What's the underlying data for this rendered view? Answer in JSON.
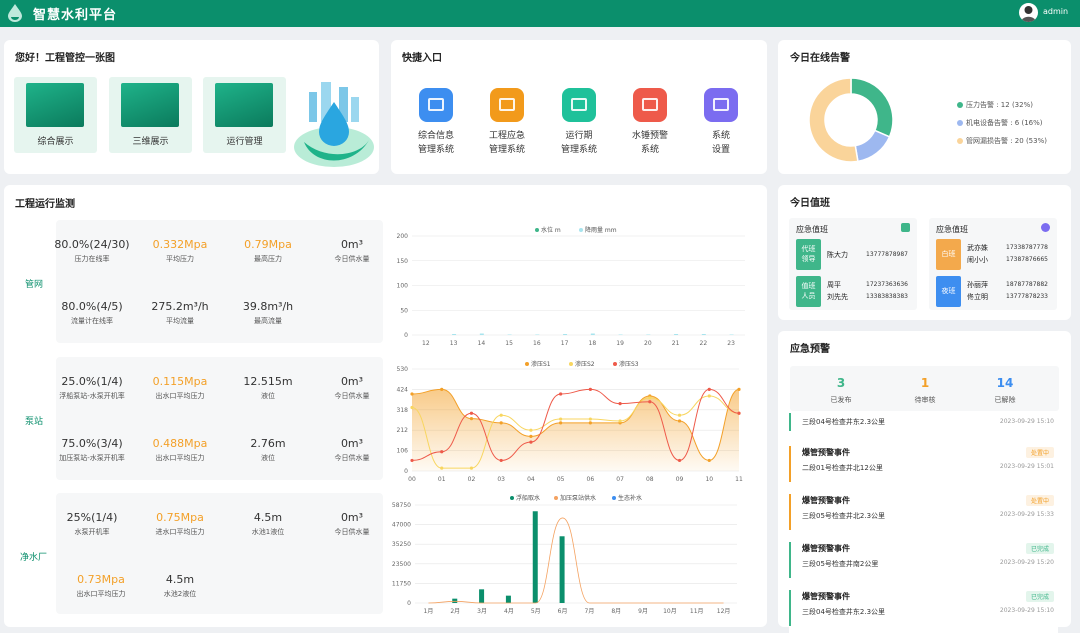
{
  "app": {
    "title": "智慧水利平台",
    "user": "admin"
  },
  "overview": {
    "title": "您好！工程管控一张图",
    "tiles": [
      "综合展示",
      "三维展示",
      "运行管理"
    ]
  },
  "quick": {
    "title": "快捷入口",
    "items": [
      {
        "l1": "综合信息",
        "l2": "管理系统",
        "color": "#3d8ef0"
      },
      {
        "l1": "工程应急",
        "l2": "管理系统",
        "color": "#f29a1b"
      },
      {
        "l1": "运行期",
        "l2": "管理系统",
        "color": "#1fc19a"
      },
      {
        "l1": "水锤预警",
        "l2": "系统",
        "color": "#ee5a4a"
      },
      {
        "l1": "系统",
        "l2": "设置",
        "color": "#7b6cf0"
      }
    ]
  },
  "alarms": {
    "title": "今日在线告警",
    "items": [
      {
        "label": "压力告警 : 12 (32%)",
        "value": 12,
        "color": "#3fb68a"
      },
      {
        "label": "机电设备告警 : 6 (16%)",
        "value": 6,
        "color": "#9db8f0"
      },
      {
        "label": "管网漏损告警 : 20 (53%)",
        "value": 20,
        "color": "#fad49a"
      }
    ]
  },
  "monitor": {
    "title": "工程运行监测",
    "sections": [
      {
        "name": "管网",
        "rows": [
          [
            {
              "v": "80.0%(24/30)",
              "l": "压力在线率"
            },
            {
              "v": "0.332Mpa",
              "l": "平均压力",
              "o": true
            },
            {
              "v": "0.79Mpa",
              "l": "最高压力",
              "o": true
            },
            {
              "v": "0m³",
              "l": "今日供水量"
            }
          ],
          [
            {
              "v": "80.0%(4/5)",
              "l": "流量计在线率"
            },
            {
              "v": "275.2m³/h",
              "l": "平均流量"
            },
            {
              "v": "39.8m³/h",
              "l": "最高流量"
            }
          ]
        ]
      },
      {
        "name": "泵站",
        "rows": [
          [
            {
              "v": "25.0%(1/4)",
              "l": "浮船泵站-水泵开机率"
            },
            {
              "v": "0.115Mpa",
              "l": "出水口平均压力",
              "o": true
            },
            {
              "v": "12.515m",
              "l": "液位"
            },
            {
              "v": "0m³",
              "l": "今日供水量"
            }
          ],
          [
            {
              "v": "75.0%(3/4)",
              "l": "加压泵站-水泵开机率"
            },
            {
              "v": "0.488Mpa",
              "l": "出水口平均压力",
              "o": true
            },
            {
              "v": "2.76m",
              "l": "液位"
            },
            {
              "v": "0m³",
              "l": "今日供水量"
            }
          ]
        ]
      },
      {
        "name": "净水厂",
        "rows": [
          [
            {
              "v": "25%(1/4)",
              "l": "水泵开机率"
            },
            {
              "v": "0.75Mpa",
              "l": "进水口平均压力",
              "o": true
            },
            {
              "v": "4.5m",
              "l": "水池1液位"
            },
            {
              "v": "0m³",
              "l": "今日供水量"
            }
          ],
          [
            {
              "v": "0.73Mpa",
              "l": "出水口平均压力",
              "o": true
            },
            {
              "v": "4.5m",
              "l": "水池2液位"
            }
          ]
        ]
      }
    ]
  },
  "chart_data": [
    {
      "type": "bar",
      "categories": [
        "12",
        "13",
        "14",
        "15",
        "16",
        "17",
        "18",
        "19",
        "20",
        "21",
        "22",
        "23"
      ],
      "series": [
        {
          "name": "水位 m",
          "values": [
            0,
            0,
            0,
            0,
            0,
            0,
            0,
            0,
            0,
            0,
            0,
            0
          ],
          "color": "#3fb68a"
        },
        {
          "name": "降雨量 mm",
          "values": [
            0,
            2,
            3,
            1,
            1,
            2,
            3,
            1,
            1,
            2,
            2,
            1
          ],
          "color": "#a8e4ee"
        }
      ],
      "yticks": [
        "200",
        "150",
        "100",
        "50",
        "0"
      ],
      "ylim": [
        0,
        200
      ]
    },
    {
      "type": "line",
      "categories": [
        "00",
        "01",
        "02",
        "03",
        "04",
        "05",
        "06",
        "07",
        "08",
        "09",
        "10",
        "11"
      ],
      "series": [
        {
          "name": "渗压S1",
          "values": [
            400,
            424,
            272,
            250,
            180,
            250,
            250,
            250,
            390,
            260,
            55,
            424
          ],
          "color": "#f3a028"
        },
        {
          "name": "渗压S2",
          "values": [
            330,
            15,
            15,
            290,
            212,
            270,
            270,
            260,
            380,
            290,
            390,
            300
          ],
          "color": "#f8d660"
        },
        {
          "name": "渗压S3",
          "values": [
            55,
            100,
            300,
            55,
            150,
            400,
            424,
            350,
            360,
            55,
            424,
            300
          ],
          "color": "#ee5a4a"
        }
      ],
      "yticks": [
        "530",
        "424",
        "318",
        "212",
        "106",
        "0"
      ],
      "ylim": [
        0,
        530
      ]
    },
    {
      "type": "bar",
      "categories": [
        "1月",
        "2月",
        "3月",
        "4月",
        "5月",
        "6月",
        "7月",
        "8月",
        "9月",
        "10月",
        "11月",
        "12月"
      ],
      "series": [
        {
          "name": "浮船取水",
          "values": [
            0,
            2600,
            8200,
            4400,
            55000,
            40000,
            0,
            0,
            0,
            0,
            0,
            0
          ],
          "color": "#0b8f6c"
        },
        {
          "name": "加压泵站供水",
          "values": [
            0,
            1000,
            0,
            0,
            0,
            51000,
            0,
            0,
            0,
            0,
            0,
            0
          ],
          "color": "#f4a261"
        },
        {
          "name": "生态补水",
          "values": [
            0,
            0,
            0,
            0,
            0,
            0,
            0,
            0,
            0,
            0,
            0,
            0
          ],
          "color": "#3d8ef0"
        }
      ],
      "yticks": [
        "58750",
        "47000",
        "35250",
        "23500",
        "11750",
        "0"
      ],
      "ylim": [
        0,
        58750
      ]
    }
  ],
  "duty": {
    "title": "今日值班",
    "groups": [
      {
        "title": "应急值班",
        "rows": [
          {
            "tag": "代班\n领导",
            "color": "#3fb68a",
            "names": [
              "陈大力"
            ],
            "phones": [
              "13777878987"
            ]
          },
          {
            "tag": "值班\n人员",
            "color": "#3fb68a",
            "names": [
              "周平",
              "刘先先"
            ],
            "phones": [
              "17237363636",
              "13383838383"
            ]
          }
        ]
      },
      {
        "title": "应急值班",
        "rows": [
          {
            "tag": "白班",
            "color": "#f3a94c",
            "names": [
              "武亦姝",
              "闹小小"
            ],
            "phones": [
              "17338787778",
              "17387876665"
            ]
          },
          {
            "tag": "夜班",
            "color": "#3d8ef0",
            "names": [
              "孙丽萍",
              "佟立明"
            ],
            "phones": [
              "18787787882",
              "13777878233"
            ]
          }
        ]
      }
    ]
  },
  "warning": {
    "title": "应急预警",
    "stats": [
      {
        "v": "3",
        "l": "已发布",
        "c": "#3fb68a"
      },
      {
        "v": "1",
        "l": "待审核",
        "c": "#f3a028"
      },
      {
        "v": "14",
        "l": "已解除",
        "c": "#3d8ef0"
      }
    ],
    "items": [
      {
        "t": "",
        "d": "三段04号检查井东2.3公里",
        "time": "2023-09-29 15:10",
        "bar": "#3fb68a",
        "status": ""
      },
      {
        "t": "爆管预警事件",
        "d": "二段01号检查井北12公里",
        "time": "2023-09-29 15:01",
        "bar": "#f3a028",
        "status": "处置中",
        "sc": "#f3a028",
        "sb": "#fdf1e1"
      },
      {
        "t": "爆管预警事件",
        "d": "三段05号检查井北2.3公里",
        "time": "2023-09-29 15:33",
        "bar": "#f3a028",
        "status": "处置中",
        "sc": "#f3a028",
        "sb": "#fdf1e1"
      },
      {
        "t": "爆管预警事件",
        "d": "三段05号检查井南2公里",
        "time": "2023-09-29 15:20",
        "bar": "#3fb68a",
        "status": "已完成",
        "sc": "#3fb68a",
        "sb": "#e3f5ec"
      },
      {
        "t": "爆管预警事件",
        "d": "三段04号检查井东2.3公里",
        "time": "2023-09-29 15:10",
        "bar": "#3fb68a",
        "status": "已完成",
        "sc": "#3fb68a",
        "sb": "#e3f5ec"
      }
    ]
  }
}
